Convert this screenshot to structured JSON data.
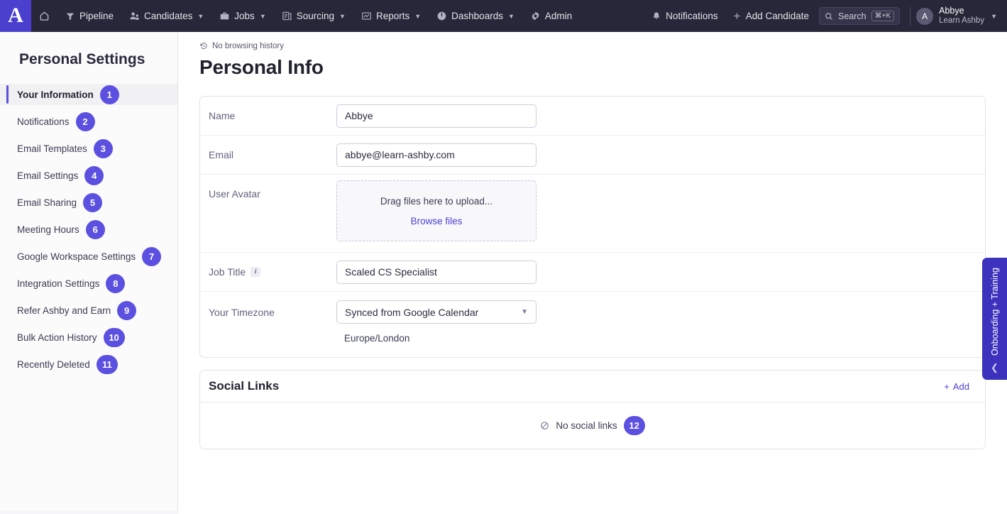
{
  "topnav": {
    "logo_letter": "A",
    "items": [
      {
        "label": "",
        "icon": "home-icon",
        "name": "nav-home",
        "caret": false
      },
      {
        "label": "Pipeline",
        "icon": "funnel-icon",
        "name": "nav-pipeline",
        "caret": false
      },
      {
        "label": "Candidates",
        "icon": "people-icon",
        "name": "nav-candidates",
        "caret": true
      },
      {
        "label": "Jobs",
        "icon": "briefcase-icon",
        "name": "nav-jobs",
        "caret": true
      },
      {
        "label": "Sourcing",
        "icon": "sourcing-icon",
        "name": "nav-sourcing",
        "caret": true
      },
      {
        "label": "Reports",
        "icon": "chart-icon",
        "name": "nav-reports",
        "caret": true
      },
      {
        "label": "Dashboards",
        "icon": "gauge-icon",
        "name": "nav-dashboards",
        "caret": true
      },
      {
        "label": "Admin",
        "icon": "gear-icon",
        "name": "nav-admin",
        "caret": false
      }
    ],
    "notifications_label": "Notifications",
    "add_candidate_label": "Add Candidate",
    "search_placeholder": "Search",
    "search_shortcut": "⌘+K",
    "user": {
      "initial": "A",
      "name": "Abbye",
      "org": "Learn Ashby"
    }
  },
  "sidebar": {
    "title": "Personal Settings",
    "items": [
      {
        "label": "Your Information",
        "badge": "1",
        "active": true
      },
      {
        "label": "Notifications",
        "badge": "2",
        "active": false
      },
      {
        "label": "Email Templates",
        "badge": "3",
        "active": false
      },
      {
        "label": "Email Settings",
        "badge": "4",
        "active": false
      },
      {
        "label": "Email Sharing",
        "badge": "5",
        "active": false
      },
      {
        "label": "Meeting Hours",
        "badge": "6",
        "active": false
      },
      {
        "label": "Google Workspace Settings",
        "badge": "7",
        "active": false
      },
      {
        "label": "Integration Settings",
        "badge": "8",
        "active": false
      },
      {
        "label": "Refer Ashby and Earn",
        "badge": "9",
        "active": false
      },
      {
        "label": "Bulk Action History",
        "badge": "10",
        "active": false
      },
      {
        "label": "Recently Deleted",
        "badge": "11",
        "active": false
      }
    ]
  },
  "main": {
    "breadcrumb": "No browsing history",
    "page_title": "Personal Info",
    "form": {
      "name": {
        "label": "Name",
        "value": "Abbye"
      },
      "email": {
        "label": "Email",
        "value": "abbye@learn-ashby.com"
      },
      "avatar": {
        "label": "User Avatar",
        "drop_text": "Drag files here to upload...",
        "browse_label": "Browse files"
      },
      "job_title": {
        "label": "Job Title",
        "value": "Scaled CS Specialist",
        "info": "i"
      },
      "timezone": {
        "label": "Your Timezone",
        "value": "Synced from Google Calendar",
        "resolved": "Europe/London"
      }
    },
    "social_links": {
      "title": "Social Links",
      "add_label": "Add",
      "empty_text": "No social links",
      "empty_badge": "12"
    }
  },
  "drawer": {
    "label": "Onboarding + Training"
  },
  "colors": {
    "brand_purple": "#5b50e0",
    "logo_purple": "#4b3fce",
    "nav_bg": "#262738",
    "drawer_bg": "#3d32bd",
    "link": "#4b41d1"
  }
}
